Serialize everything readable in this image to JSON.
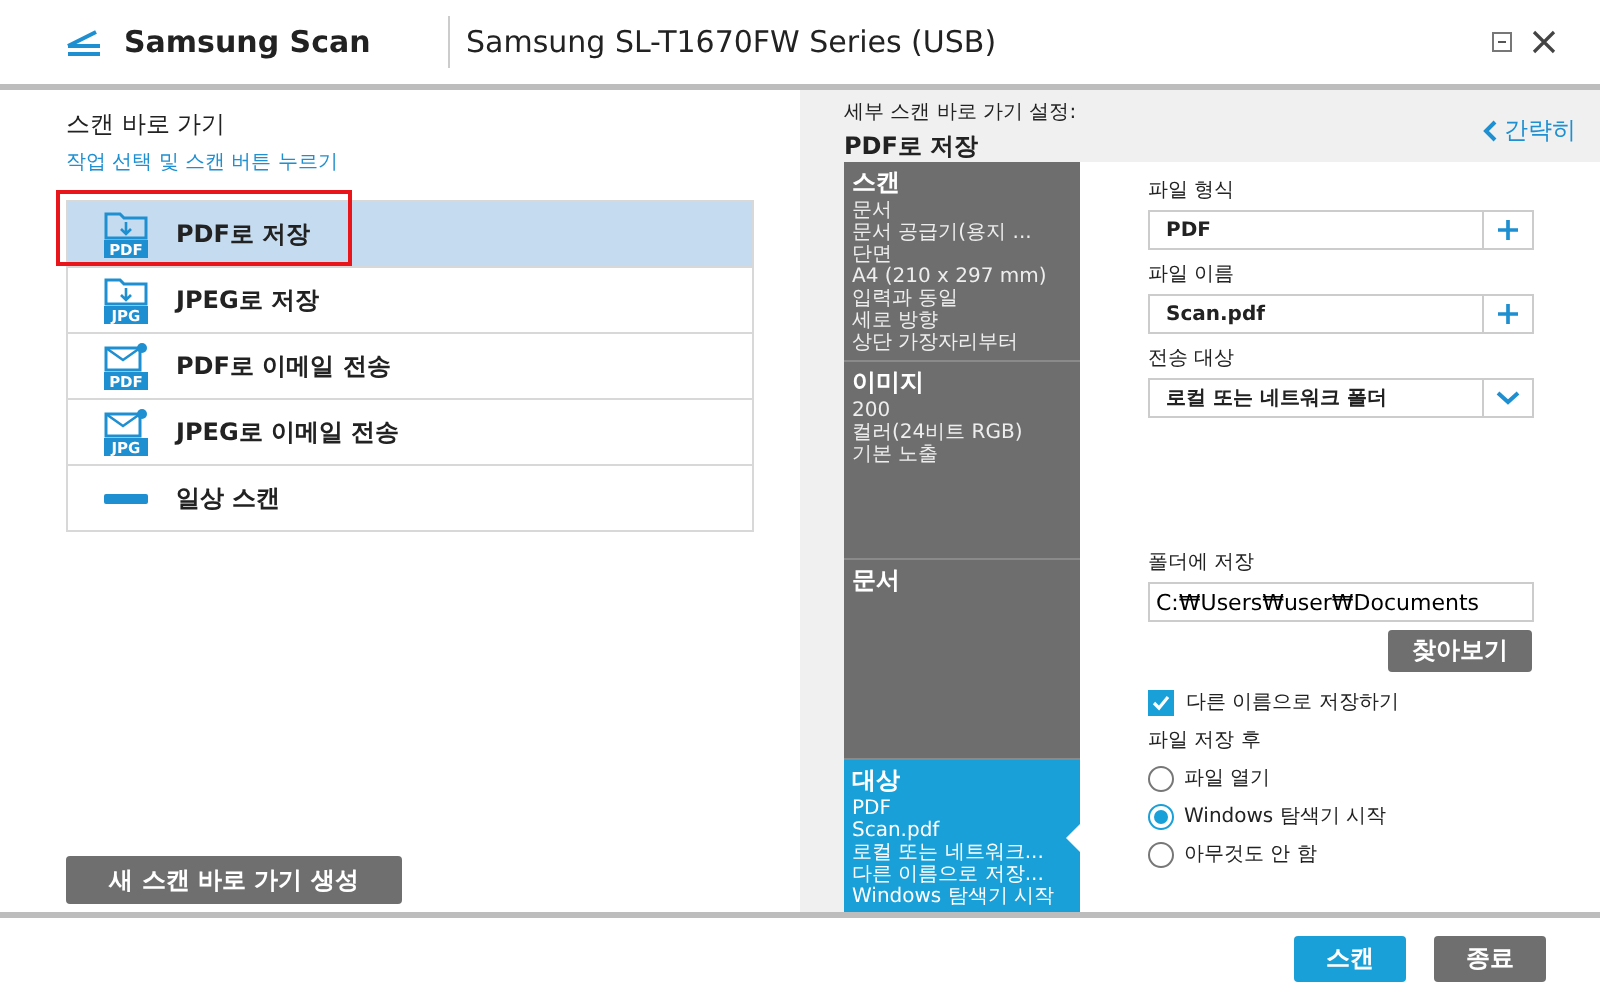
{
  "header": {
    "app_name": "Samsung Scan",
    "device": "Samsung SL-T1670FW Series (USB)"
  },
  "left": {
    "title": "스캔 바로 가기",
    "subtitle": "작업 선택 및 스캔 버튼 누르기",
    "shortcuts": [
      {
        "label": "PDF로 저장",
        "kind": "folder",
        "badge": "PDF",
        "selected": true,
        "highlighted": true
      },
      {
        "label": "JPEG로 저장",
        "kind": "folder",
        "badge": "JPG",
        "selected": false,
        "highlighted": false
      },
      {
        "label": "PDF로 이메일 전송",
        "kind": "mail",
        "badge": "PDF",
        "selected": false,
        "highlighted": false
      },
      {
        "label": "JPEG로 이메일 전송",
        "kind": "mail",
        "badge": "JPG",
        "selected": false,
        "highlighted": false
      },
      {
        "label": "일상 스캔",
        "kind": "plain",
        "selected": false,
        "highlighted": false
      }
    ],
    "new_button": "새 스캔 바로 가기 생성"
  },
  "right": {
    "heading_label": "세부 스캔 바로 가기 설정:",
    "heading_value": "PDF로 저장",
    "simple_link": "간략히",
    "summary": [
      {
        "title": "스캔",
        "lines": [
          "문서",
          "문서 공급기(용지 ...",
          "단면",
          "A4 (210 x 297 mm)",
          "입력과 동일",
          "세로 방향",
          "상단 가장자리부터"
        ],
        "selected": false
      },
      {
        "title": "이미지",
        "lines": [
          "200",
          "컬러(24비트 RGB)",
          "기본 노출"
        ],
        "selected": false
      },
      {
        "title": "문서",
        "selected": false
      },
      {
        "title": "대상",
        "lines": [
          "PDF",
          "Scan.pdf",
          "로컬 또는 네트워크...",
          "다른 이름으로 저장...",
          "Windows 탐색기 시작"
        ],
        "selected": true
      }
    ],
    "fields": [
      {
        "label": "파일 형식",
        "value": "PDF",
        "kind": "add"
      },
      {
        "label": "파일 이름",
        "value": "Scan.pdf",
        "kind": "add"
      },
      {
        "label": "전송 대상",
        "value": "로컬 또는 네트워크 폴더",
        "kind": "dropdown"
      }
    ],
    "folder": {
      "label": "폴더에 저장",
      "value": "C:₩Users₩user₩Documents",
      "browse": "찾아보기"
    },
    "save_as": {
      "label": "다른 이름으로 저장하기",
      "checked": true
    },
    "after_label": "파일 저장 후",
    "after_options": [
      {
        "label": "파일 열기",
        "selected": false
      },
      {
        "label": "Windows 탐색기 시작",
        "selected": true
      },
      {
        "label": "아무것도 안 함",
        "selected": false
      }
    ]
  },
  "footer": {
    "buttons": [
      {
        "label": "스캔",
        "kind": "primary"
      },
      {
        "label": "종료",
        "kind": "secondary"
      }
    ]
  }
}
